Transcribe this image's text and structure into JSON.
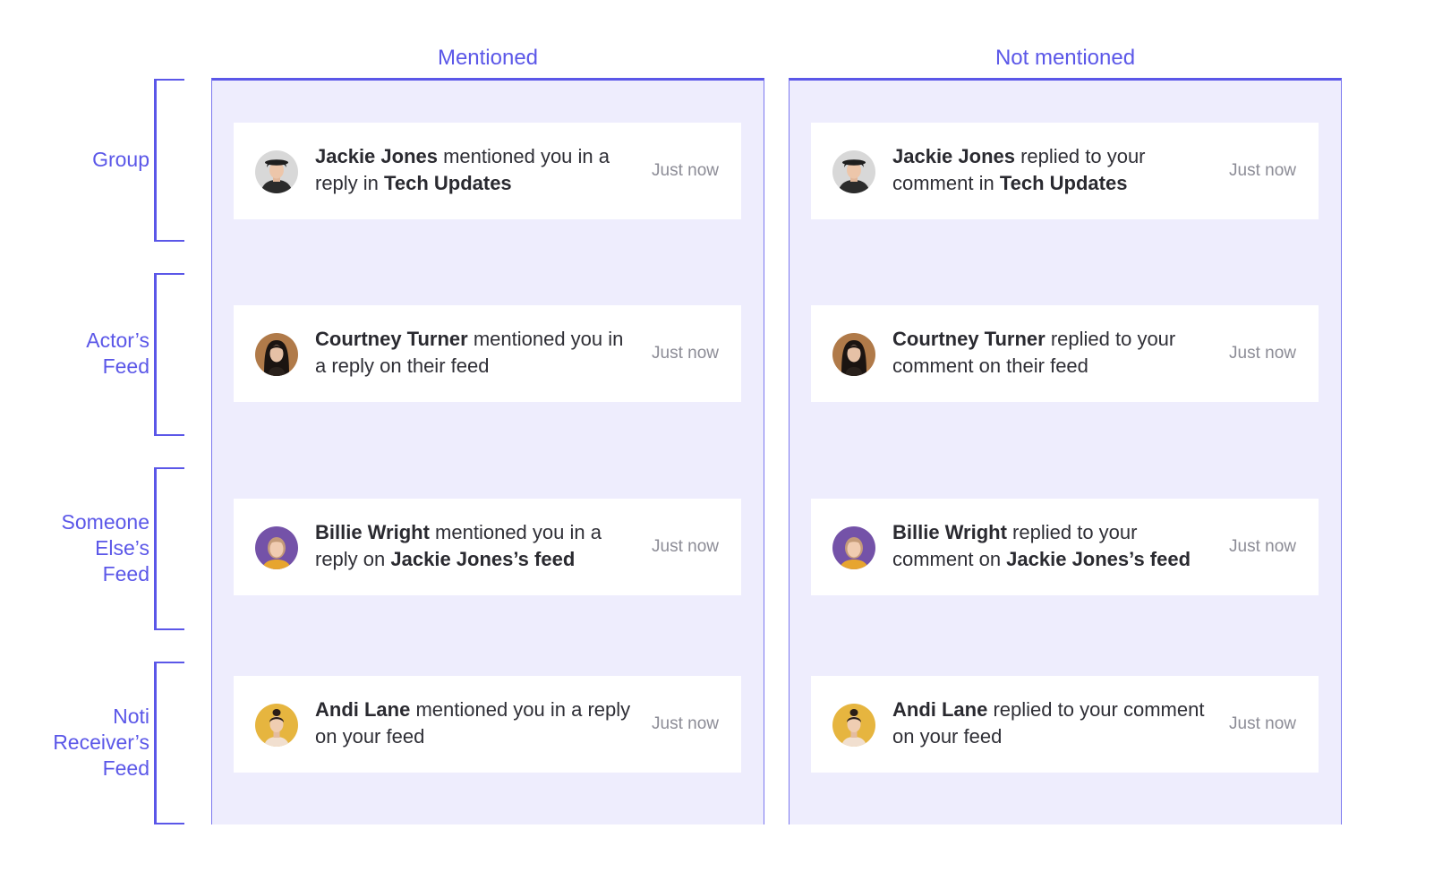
{
  "columns": [
    {
      "title": "Mentioned"
    },
    {
      "title": "Not mentioned"
    }
  ],
  "rows": [
    {
      "label_lines": [
        "Group"
      ]
    },
    {
      "label_lines": [
        "Actor’s",
        "Feed"
      ]
    },
    {
      "label_lines": [
        "Someone",
        "Else’s",
        "Feed"
      ]
    },
    {
      "label_lines": [
        "Noti",
        "Receiver’s",
        "Feed"
      ]
    }
  ],
  "cards": {
    "mentioned": [
      {
        "actor": "Jackie Jones",
        "text": " mentioned you in a reply in ",
        "target": "Tech Updates",
        "time": "Just now",
        "avatar": "avatar-jackie-jones"
      },
      {
        "actor": "Courtney Turner",
        "text": " mentioned you in a reply on their feed",
        "target": "",
        "time": "Just now",
        "avatar": "avatar-courtney-turner"
      },
      {
        "actor": "Billie Wright",
        "text": " mentioned you in a reply on ",
        "target": "Jackie Jones’s feed",
        "time": "Just now",
        "avatar": "avatar-billie-wright"
      },
      {
        "actor": "Andi Lane",
        "text": " mentioned you in a reply on your feed",
        "target": "",
        "time": "Just now",
        "avatar": "avatar-andi-lane"
      }
    ],
    "not_mentioned": [
      {
        "actor": "Jackie Jones",
        "text": " replied to your comment in ",
        "target": "Tech Updates",
        "time": "Just now",
        "avatar": "avatar-jackie-jones"
      },
      {
        "actor": "Courtney Turner",
        "text": " replied to your comment on their feed",
        "target": "",
        "time": "Just now",
        "avatar": "avatar-courtney-turner"
      },
      {
        "actor": "Billie Wright",
        "text": " replied to your comment on ",
        "target": "Jackie Jones’s feed",
        "time": "Just now",
        "avatar": "avatar-billie-wright"
      },
      {
        "actor": "Andi Lane",
        "text": " replied to your comment on your feed",
        "target": "",
        "time": "Just now",
        "avatar": "avatar-andi-lane"
      }
    ]
  },
  "colors": {
    "accent": "#5b57e8",
    "column_bg": "#eeedfd",
    "card_bg": "#ffffff",
    "time_text": "#8c8c96"
  }
}
